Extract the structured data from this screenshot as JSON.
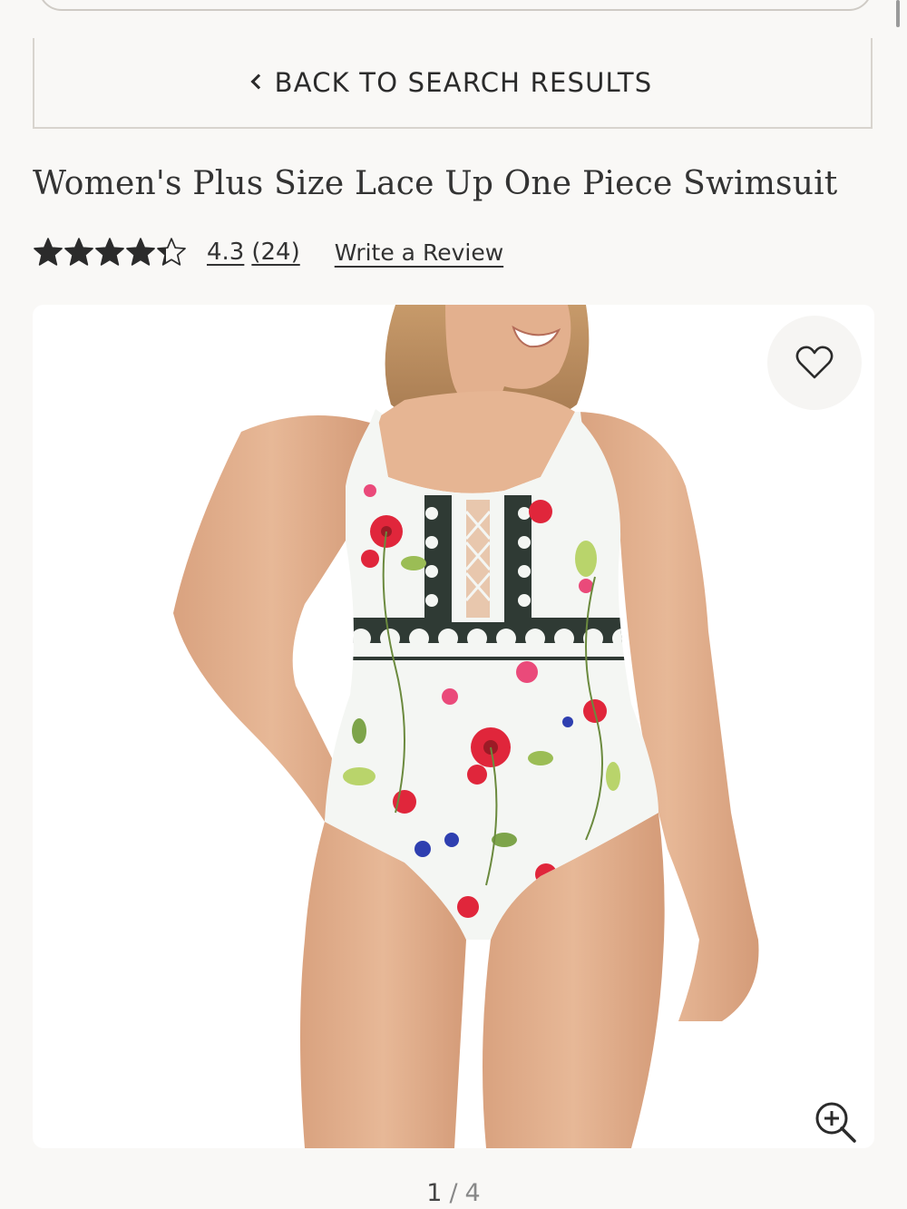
{
  "back_button": {
    "label": "BACK TO SEARCH RESULTS",
    "icon": "chevron-left-icon"
  },
  "product": {
    "title": "Women's Plus Size Lace Up One Piece Swimsuit",
    "rating": {
      "value": "4.3",
      "count": "(24)",
      "stars_filled": 4.3,
      "stars_max": 5
    },
    "write_review_label": "Write a Review"
  },
  "gallery": {
    "current": "1",
    "separator": "/",
    "total": "4",
    "favorite_icon": "heart-outline-icon",
    "zoom_icon": "zoom-in-icon"
  },
  "colors": {
    "background": "#f9f8f6",
    "text": "#2b2b2b",
    "accent_red": "#e0263b"
  }
}
